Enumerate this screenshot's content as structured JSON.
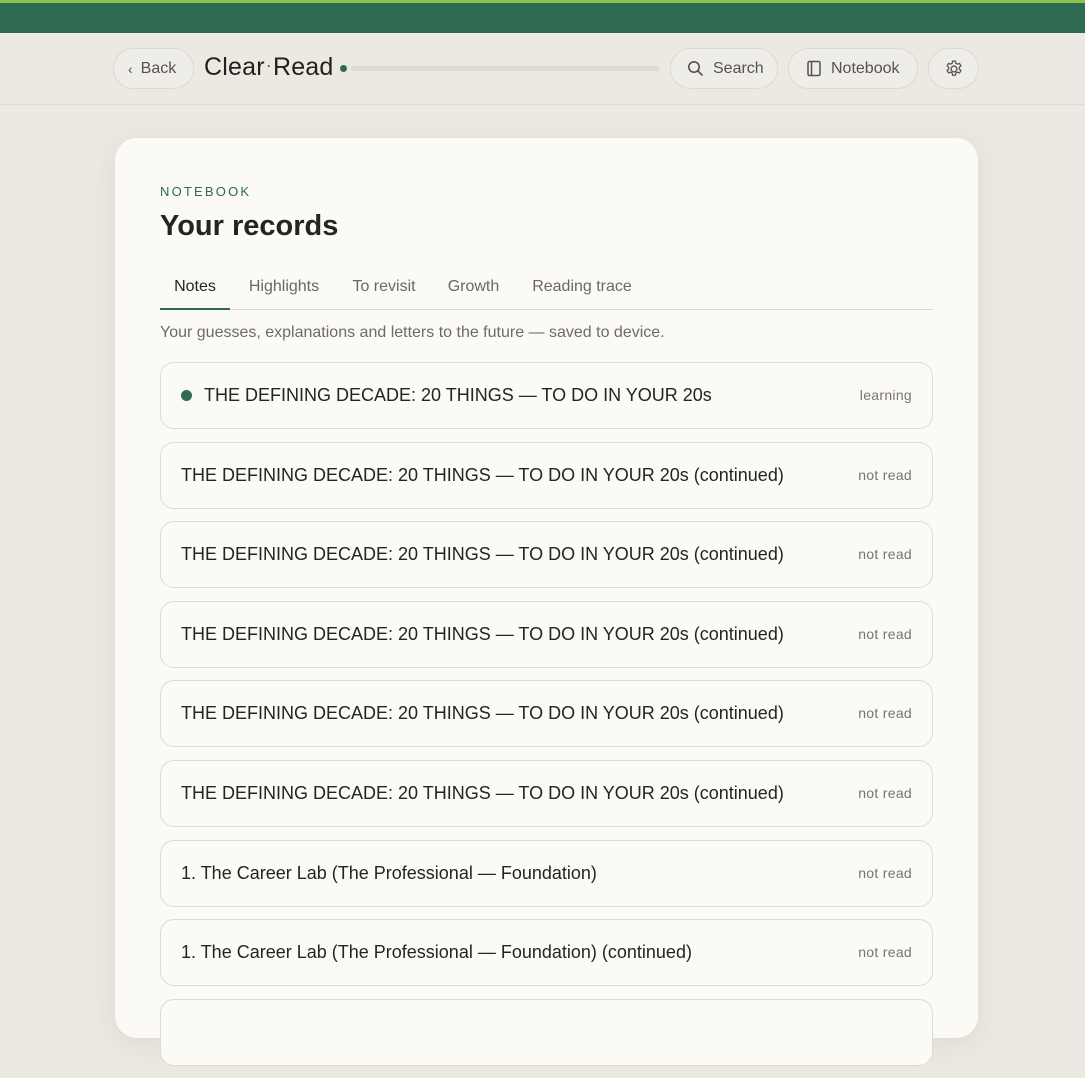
{
  "header": {
    "back_label": "Back",
    "brand_left": "Clear",
    "brand_sep": "·",
    "brand_right": "Read",
    "reading_progress": 0,
    "search_label": "Search",
    "notebook_label": "Notebook"
  },
  "notebook": {
    "eyebrow": "NOTEBOOK",
    "title": "Your records",
    "tabs": [
      {
        "label": "Notes",
        "active": true
      },
      {
        "label": "Highlights",
        "active": false
      },
      {
        "label": "To revisit",
        "active": false
      },
      {
        "label": "Growth",
        "active": false
      },
      {
        "label": "Reading trace",
        "active": false
      }
    ],
    "subtitle": "Your guesses, explanations and letters to the future — saved to device.",
    "items": [
      {
        "label": "THE DEFINING DECADE: 20 THINGS — TO DO IN YOUR 20s",
        "status": "learning",
        "active": true
      },
      {
        "label": "THE DEFINING DECADE: 20 THINGS — TO DO IN YOUR 20s (continued)",
        "status": "not read",
        "active": false
      },
      {
        "label": "THE DEFINING DECADE: 20 THINGS — TO DO IN YOUR 20s (continued)",
        "status": "not read",
        "active": false
      },
      {
        "label": "THE DEFINING DECADE: 20 THINGS — TO DO IN YOUR 20s (continued)",
        "status": "not read",
        "active": false
      },
      {
        "label": "THE DEFINING DECADE: 20 THINGS — TO DO IN YOUR 20s (continued)",
        "status": "not read",
        "active": false
      },
      {
        "label": "THE DEFINING DECADE: 20 THINGS — TO DO IN YOUR 20s (continued)",
        "status": "not read",
        "active": false
      },
      {
        "label": "1. The Career Lab (The Professional — Foundation)",
        "status": "not read",
        "active": false
      },
      {
        "label": "1. The Career Lab (The Professional — Foundation) (continued)",
        "status": "not read",
        "active": false
      },
      {
        "label": "",
        "status": "",
        "active": false
      }
    ]
  },
  "colors": {
    "accent": "#2f6a52",
    "topbar": "#2f6a52",
    "topbar_highlight": "#8bc34a",
    "background": "#ebe9e2",
    "card": "#fbfaf5"
  }
}
